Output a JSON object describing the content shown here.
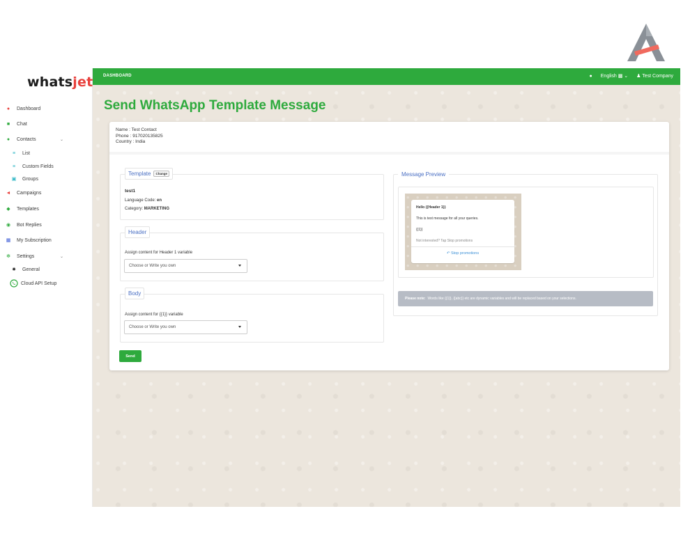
{
  "brand": {
    "part1": "whats",
    "part2": "jet"
  },
  "sidebar": {
    "items": [
      {
        "label": "Dashboard",
        "icon": "palette-icon",
        "color": "#e8403c"
      },
      {
        "label": "Chat",
        "icon": "chat-icon",
        "color": "#2eaa3d"
      },
      {
        "label": "Contacts",
        "icon": "users-icon",
        "color": "#2eaa3d",
        "expanded": true
      },
      {
        "label": "List",
        "icon": "list-icon",
        "color": "#2bb5c4"
      },
      {
        "label": "Custom Fields",
        "icon": "bars-icon",
        "color": "#2bb5c4"
      },
      {
        "label": "Groups",
        "icon": "square-icon",
        "color": "#2bb5c4"
      },
      {
        "label": "Campaigns",
        "icon": "megaphone-icon",
        "color": "#e8403c"
      },
      {
        "label": "Templates",
        "icon": "layers-icon",
        "color": "#2eaa3d"
      },
      {
        "label": "Bot Replies",
        "icon": "robot-icon",
        "color": "#2eaa3d"
      },
      {
        "label": "My Subscription",
        "icon": "card-icon",
        "color": "#3b5bd6"
      },
      {
        "label": "Settings",
        "icon": "cogs-icon",
        "color": "#2eaa3d"
      },
      {
        "label": "General",
        "icon": "gear-icon",
        "color": "#333333"
      },
      {
        "label": "Cloud API Setup",
        "icon": "whatsapp-icon",
        "color": "#2eaa3d"
      }
    ]
  },
  "topbar": {
    "section": "DASHBOARD",
    "language": "English",
    "user": "Test Company"
  },
  "page": {
    "title": "Send WhatsApp Template Message"
  },
  "contact": {
    "name": "Name : Test Contact",
    "phone": "Phone : 917020135825",
    "country": "Country : India"
  },
  "template": {
    "legend": "Template",
    "change_label": "Change",
    "name": "test1",
    "language_label": "Language Code:",
    "language_value": "en",
    "category_label": "Category:",
    "category_value": "MARKETING"
  },
  "header": {
    "legend": "Header",
    "assign_label": "Assign content for Header 1 variable",
    "select_placeholder": "Choose or Write you own"
  },
  "body": {
    "legend": "Body",
    "assign_label": "Assign content for {{1}} variable",
    "select_placeholder": "Choose or Write you own"
  },
  "send_label": "Send",
  "preview": {
    "legend": "Message Preview",
    "header_line": "Hello {{Header 1}}",
    "body_line": "This is test message for all your queries.",
    "var_line": "{{1}}",
    "footer_line": "Not interested? Tap Stop promotions",
    "button_label": "Stop promotions"
  },
  "note": {
    "bold": "Please note:",
    "text": "Words like {{1}}, {{abc}} etc are dynamic variables and will be replaced based on your selections."
  },
  "colors": {
    "primary": "#2eaa3d",
    "accent": "#e8403c",
    "link": "#4a6fc3"
  }
}
